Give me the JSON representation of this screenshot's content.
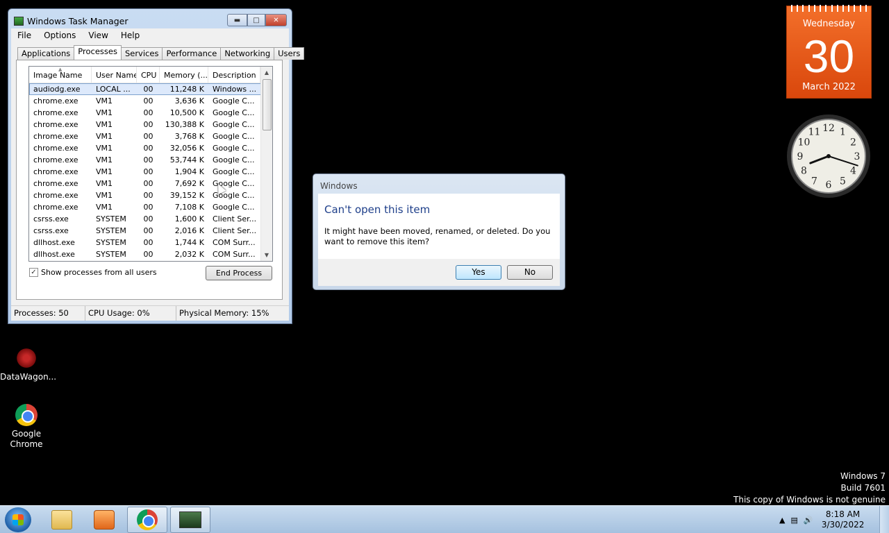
{
  "task_manager": {
    "title": "Windows Task Manager",
    "menu": [
      "File",
      "Options",
      "View",
      "Help"
    ],
    "tabs": [
      "Applications",
      "Processes",
      "Services",
      "Performance",
      "Networking",
      "Users"
    ],
    "active_tab": "Processes",
    "columns": [
      "Image Name",
      "User Name",
      "CPU",
      "Memory (...",
      "Description"
    ],
    "processes": [
      {
        "name": "audiodg.exe",
        "user": "LOCAL ...",
        "cpu": "00",
        "mem": "11,248 K",
        "desc": "Windows ..."
      },
      {
        "name": "chrome.exe",
        "user": "VM1",
        "cpu": "00",
        "mem": "3,636 K",
        "desc": "Google C..."
      },
      {
        "name": "chrome.exe",
        "user": "VM1",
        "cpu": "00",
        "mem": "10,500 K",
        "desc": "Google C..."
      },
      {
        "name": "chrome.exe",
        "user": "VM1",
        "cpu": "00",
        "mem": "130,388 K",
        "desc": "Google C..."
      },
      {
        "name": "chrome.exe",
        "user": "VM1",
        "cpu": "00",
        "mem": "3,768 K",
        "desc": "Google C..."
      },
      {
        "name": "chrome.exe",
        "user": "VM1",
        "cpu": "00",
        "mem": "32,056 K",
        "desc": "Google C..."
      },
      {
        "name": "chrome.exe",
        "user": "VM1",
        "cpu": "00",
        "mem": "53,744 K",
        "desc": "Google C..."
      },
      {
        "name": "chrome.exe",
        "user": "VM1",
        "cpu": "00",
        "mem": "1,904 K",
        "desc": "Google C..."
      },
      {
        "name": "chrome.exe",
        "user": "VM1",
        "cpu": "00",
        "mem": "7,692 K",
        "desc": "Google C..."
      },
      {
        "name": "chrome.exe",
        "user": "VM1",
        "cpu": "00",
        "mem": "39,152 K",
        "desc": "Google C..."
      },
      {
        "name": "chrome.exe",
        "user": "VM1",
        "cpu": "00",
        "mem": "7,108 K",
        "desc": "Google C..."
      },
      {
        "name": "csrss.exe",
        "user": "SYSTEM",
        "cpu": "00",
        "mem": "1,600 K",
        "desc": "Client Ser..."
      },
      {
        "name": "csrss.exe",
        "user": "SYSTEM",
        "cpu": "00",
        "mem": "2,016 K",
        "desc": "Client Ser..."
      },
      {
        "name": "dllhost.exe",
        "user": "SYSTEM",
        "cpu": "00",
        "mem": "1,744 K",
        "desc": "COM Surr..."
      },
      {
        "name": "dllhost.exe",
        "user": "SYSTEM",
        "cpu": "00",
        "mem": "2,032 K",
        "desc": "COM Surr..."
      }
    ],
    "show_all_label": "Show processes from all users",
    "show_all_checked": true,
    "end_process_label": "End Process",
    "status": {
      "processes": "Processes: 50",
      "cpu": "CPU Usage: 0%",
      "memory": "Physical Memory: 15%"
    }
  },
  "dialog": {
    "title": "Windows",
    "heading": "Can't open this item",
    "message": "It might have been moved, renamed, or deleted. Do you want to remove this item?",
    "yes_label": "Yes",
    "no_label": "No"
  },
  "desktop_icons": [
    {
      "label": "DataWagon...",
      "icon": "datawagon-icon"
    },
    {
      "label": "Google\nChrome",
      "icon": "chrome-icon"
    }
  ],
  "calendar": {
    "day": "Wednesday",
    "date": "30",
    "month_year": "March 2022"
  },
  "clock": {
    "numerals": [
      "12",
      "1",
      "2",
      "3",
      "4",
      "5",
      "6",
      "7",
      "8",
      "9",
      "10",
      "11"
    ],
    "hour": 8,
    "minute": 18
  },
  "watermark": [
    "Windows 7",
    "Build 7601",
    "This copy of Windows is not genuine"
  ],
  "taskbar": {
    "buttons": [
      "start-orb-icon",
      "folder-icon",
      "media-player-icon",
      "chrome-icon",
      "task-manager-icon"
    ],
    "time": "8:18 AM",
    "date": "3/30/2022"
  },
  "colors": {
    "accent": "#e85c17",
    "dialog_heading": "#1e3f8a",
    "selection": "#dde9fb"
  }
}
